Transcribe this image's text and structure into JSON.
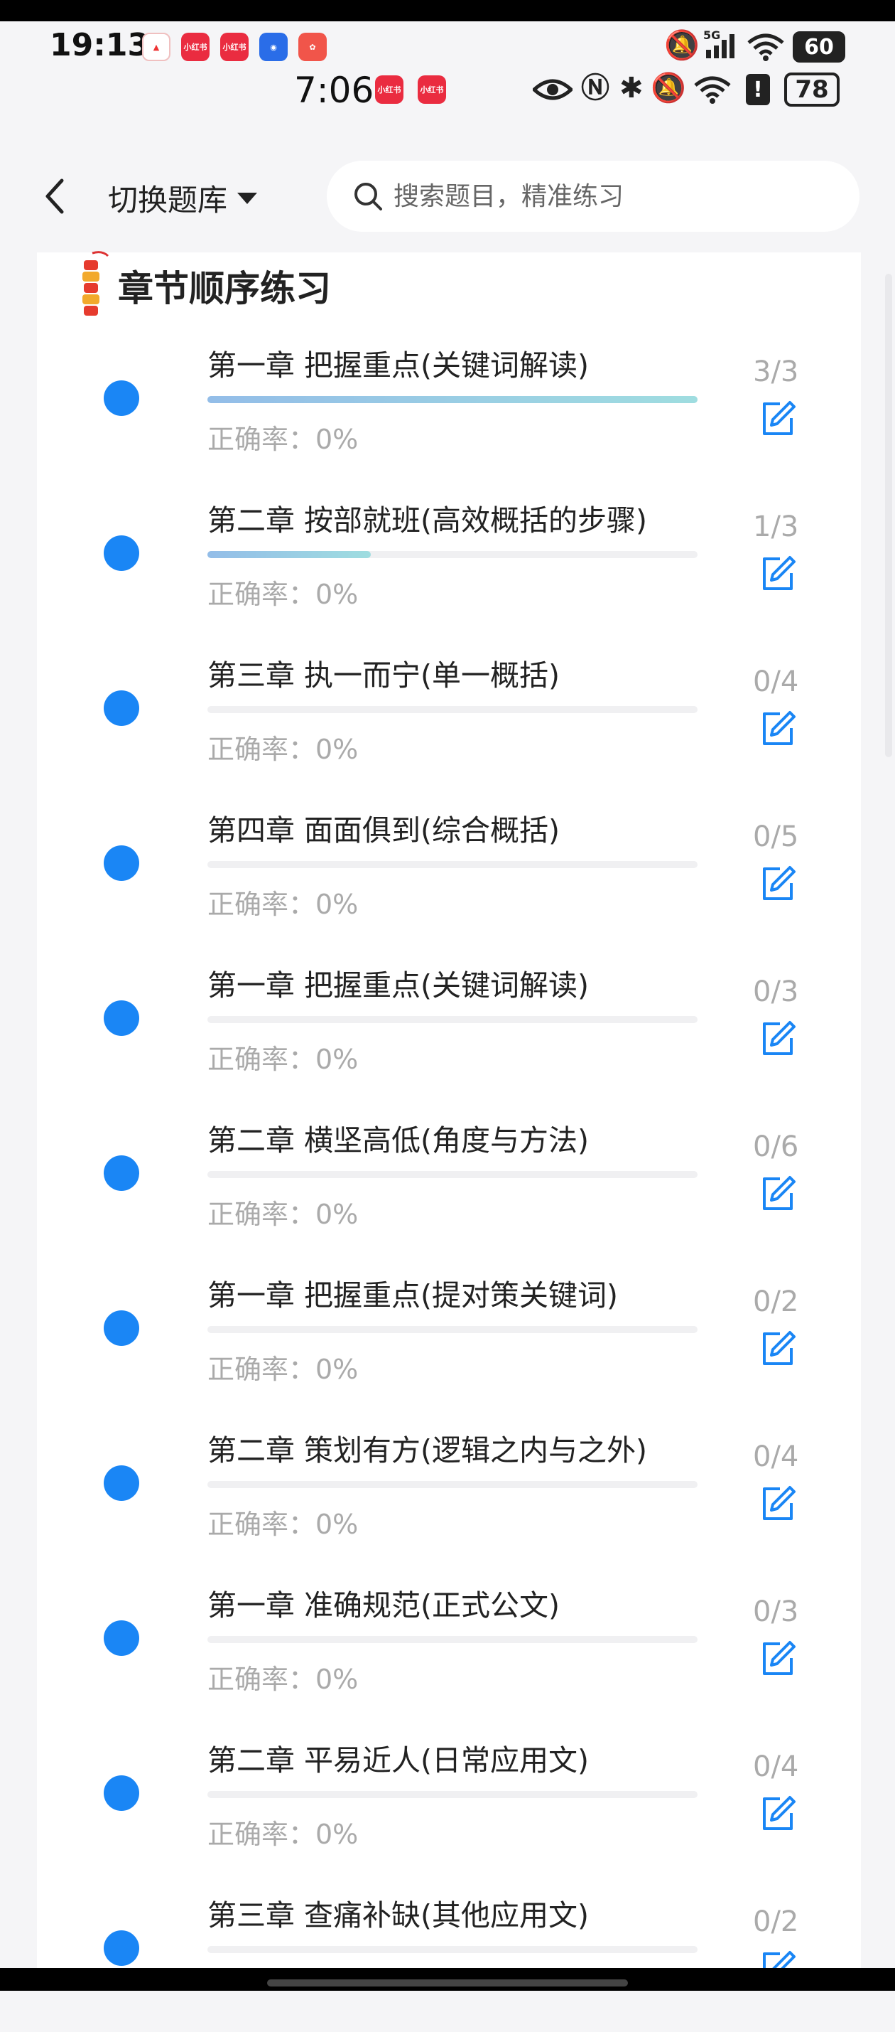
{
  "status": {
    "time1": "19:13",
    "time2": "7:06",
    "battery1": "60",
    "battery2": "78",
    "signal_label": "5G",
    "app_icon_label": "小红书",
    "accent": "#1a86f5"
  },
  "header": {
    "switch_label": "切换题库",
    "search_placeholder": "搜索题目，精准练习"
  },
  "section": {
    "title": "章节顺序练习"
  },
  "chapters": [
    {
      "title": "第一章 把握重点(关键词解读)",
      "accuracy": "正确率：0%",
      "count": "3/3",
      "progress": 1.0
    },
    {
      "title": "第二章 按部就班(高效概括的步骤)",
      "accuracy": "正确率：0%",
      "count": "1/3",
      "progress": 0.333
    },
    {
      "title": "第三章 执一而宁(单一概括)",
      "accuracy": "正确率：0%",
      "count": "0/4",
      "progress": 0
    },
    {
      "title": "第四章 面面俱到(综合概括)",
      "accuracy": "正确率：0%",
      "count": "0/5",
      "progress": 0
    },
    {
      "title": "第一章 把握重点(关键词解读)",
      "accuracy": "正确率：0%",
      "count": "0/3",
      "progress": 0
    },
    {
      "title": "第二章 横坚高低(角度与方法)",
      "accuracy": "正确率：0%",
      "count": "0/6",
      "progress": 0
    },
    {
      "title": "第一章 把握重点(提对策关键词)",
      "accuracy": "正确率：0%",
      "count": "0/2",
      "progress": 0
    },
    {
      "title": "第二章 策划有方(逻辑之内与之外)",
      "accuracy": "正确率：0%",
      "count": "0/4",
      "progress": 0
    },
    {
      "title": "第一章 准确规范(正式公文)",
      "accuracy": "正确率：0%",
      "count": "0/3",
      "progress": 0
    },
    {
      "title": "第二章 平易近人(日常应用文)",
      "accuracy": "正确率：0%",
      "count": "0/4",
      "progress": 0
    },
    {
      "title": "第三章 查痛补缺(其他应用文)",
      "accuracy": "",
      "count": "0/2",
      "progress": 0
    }
  ]
}
